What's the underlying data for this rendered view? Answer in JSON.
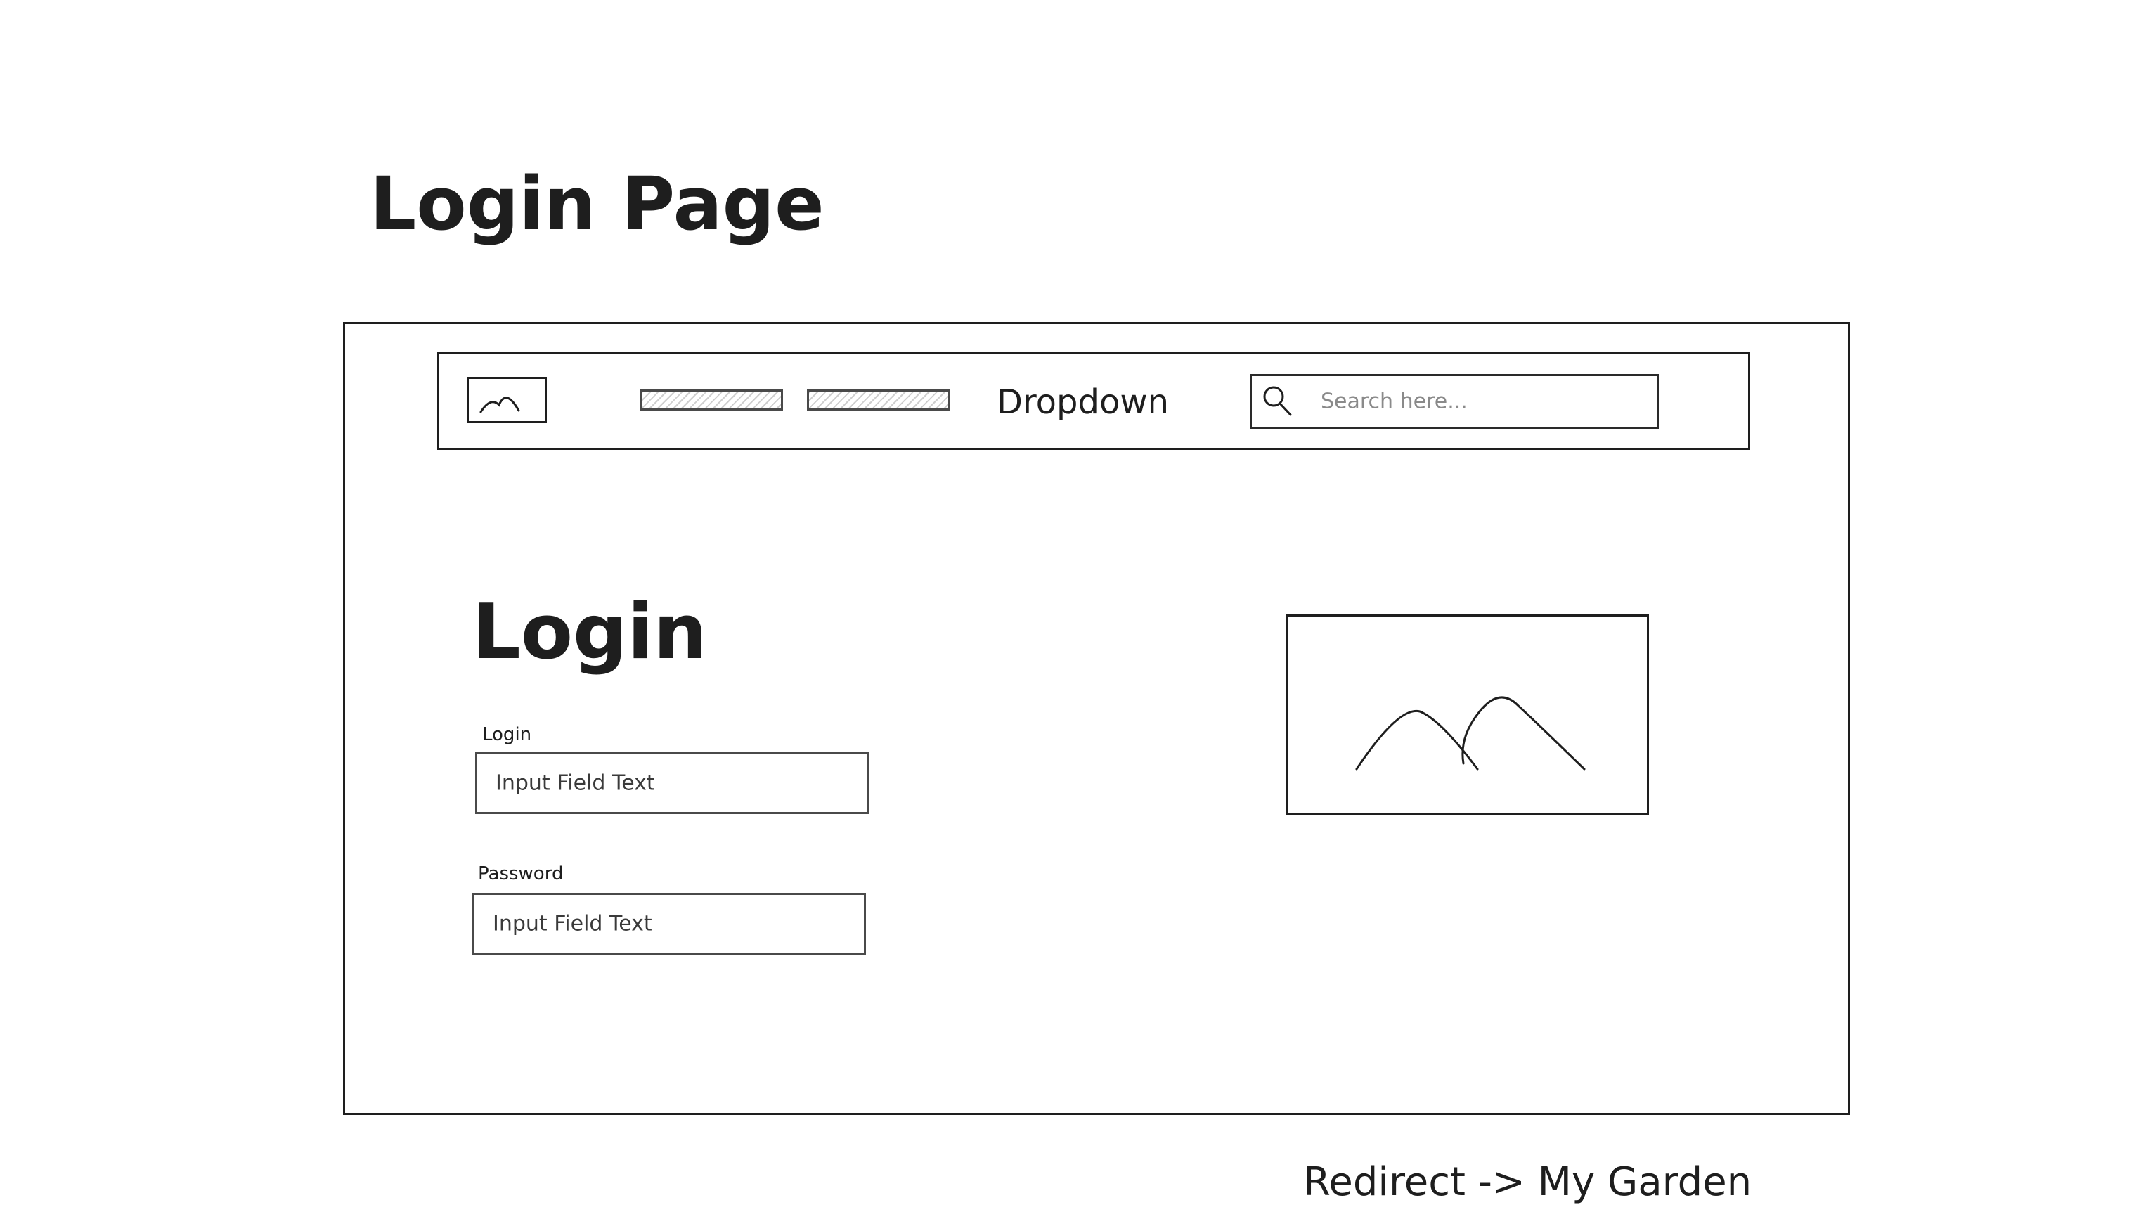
{
  "page_title": "Login Page",
  "navbar": {
    "dropdown_label": "Dropdown",
    "search": {
      "placeholder": "Search here..."
    }
  },
  "main": {
    "heading": "Login",
    "login_field": {
      "label": "Login",
      "placeholder": "Input Field Text"
    },
    "password_field": {
      "label": "Password",
      "placeholder": "Input Field Text"
    }
  },
  "footer_note": "Redirect -> My Garden",
  "icons": {
    "logo": "image-placeholder-icon",
    "search": "search-icon",
    "hero": "image-placeholder-icon"
  },
  "colors": {
    "stroke": "#1e1e1e",
    "background": "#ffffff",
    "muted": "#7a7a7a"
  }
}
